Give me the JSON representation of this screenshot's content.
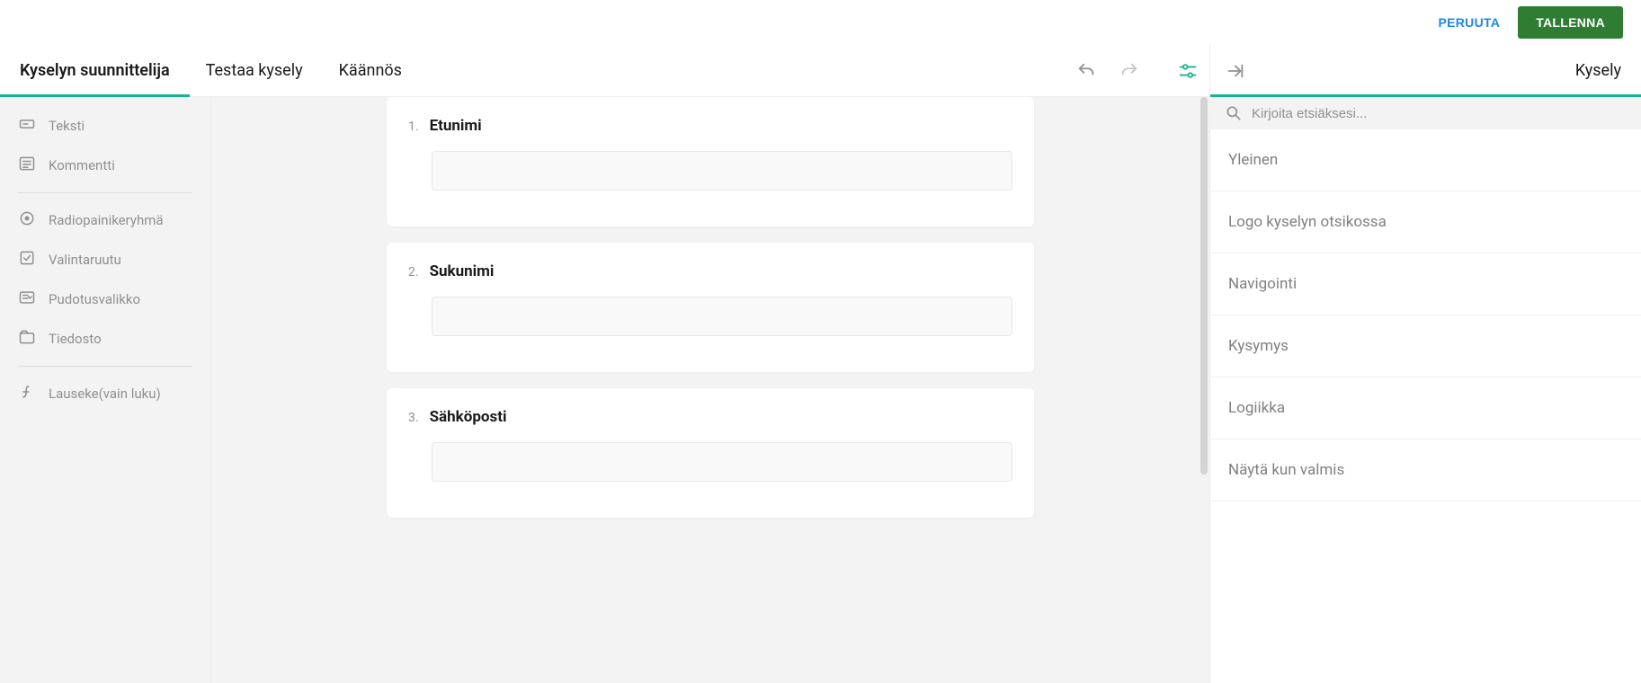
{
  "header": {
    "cancel_label": "PERUUTA",
    "save_label": "TALLENNA"
  },
  "tabs": {
    "designer": "Kyselyn suunnittelija",
    "test": "Testaa kysely",
    "translate": "Käännös"
  },
  "right_title": "Kysely",
  "toolbox": {
    "group1": [
      {
        "name": "text-item",
        "icon": "text",
        "label": "Teksti"
      },
      {
        "name": "comment-item",
        "icon": "comment",
        "label": "Kommentti"
      }
    ],
    "group2": [
      {
        "name": "radiogroup-item",
        "icon": "radio",
        "label": "Radiopainikeryhmä"
      },
      {
        "name": "checkbox-item",
        "icon": "check",
        "label": "Valintaruutu"
      },
      {
        "name": "dropdown-item",
        "icon": "dropdown",
        "label": "Pudotusvalikko"
      },
      {
        "name": "file-item",
        "icon": "file",
        "label": "Tiedosto"
      }
    ],
    "group3": [
      {
        "name": "expression-item",
        "icon": "fx",
        "label": "Lauseke(vain luku)"
      }
    ]
  },
  "questions": [
    {
      "num": "1.",
      "title": "Etunimi"
    },
    {
      "num": "2.",
      "title": "Sukunimi"
    },
    {
      "num": "3.",
      "title": "Sähköposti"
    }
  ],
  "search": {
    "placeholder": "Kirjoita etsiäksesi..."
  },
  "accordion": [
    "Yleinen",
    "Logo kyselyn otsikossa",
    "Navigointi",
    "Kysymys",
    "Logiikka",
    "Näytä kun valmis"
  ]
}
